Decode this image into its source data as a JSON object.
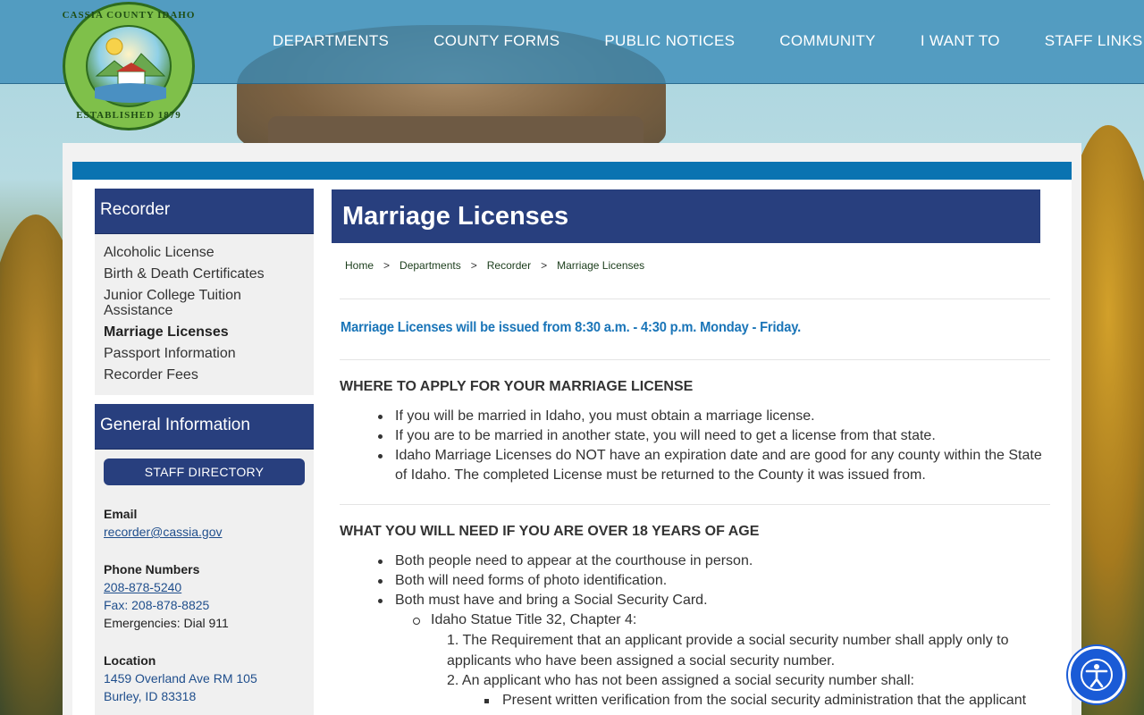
{
  "logo": {
    "top_text": "CASSIA COUNTY IDAHO",
    "bottom_text": "ESTABLISHED 1879"
  },
  "nav": {
    "items": [
      "DEPARTMENTS",
      "COUNTY FORMS",
      "PUBLIC NOTICES",
      "COMMUNITY",
      "I WANT TO",
      "STAFF LINKS"
    ]
  },
  "sidebar": {
    "title": "Recorder",
    "links": [
      "Alcoholic License",
      "Birth & Death Certificates",
      "Junior College Tuition Assistance",
      "Marriage Licenses",
      "Passport Information",
      "Recorder Fees"
    ],
    "active_link": "Marriage Licenses",
    "info_title": "General Information",
    "staff_button": "STAFF DIRECTORY",
    "email_label": "Email",
    "email": "recorder@cassia.gov",
    "phone_label": "Phone Numbers",
    "phone": "208-878-5240",
    "fax": "Fax: 208-878-8825",
    "emergencies": "Emergencies: Dial 911",
    "location_label": "Location",
    "address1": "1459 Overland Ave RM 105",
    "address2": "Burley, ID 83318"
  },
  "main": {
    "title": "Marriage Licenses",
    "breadcrumb": [
      "Home",
      "Departments",
      "Recorder",
      "Marriage Licenses"
    ],
    "breadcrumb_sep": ">",
    "hours_note": "Marriage Licenses will be issued from 8:30 a.m. - 4:30 p.m. Monday - Friday.",
    "section1": {
      "heading": "WHERE TO APPLY FOR YOUR MARRIAGE LICENSE",
      "items": [
        "If you will be married in Idaho, you must obtain a marriage license.",
        "If you are to be married in another state, you will need to get a license from that state.",
        "Idaho Marriage Licenses do NOT have an expiration date and are good for any county within the State of Idaho. The completed License must be returned to the County it was issued from."
      ]
    },
    "section2": {
      "heading": "WHAT YOU WILL NEED IF YOU ARE OVER 18 YEARS OF AGE",
      "items": [
        "Both people need to appear at the courthouse in person.",
        "Both will need forms of photo identification.",
        "Both must have and bring a Social Security Card."
      ],
      "sub_item": "Idaho Statue Title 32, Chapter 4:",
      "numbered": [
        "1. The Requirement that an applicant provide a social security number shall apply only to applicants who have been assigned a social security number.",
        "2. An applicant who has not been assigned a social security number shall:"
      ],
      "square_item": "Present written verification from the social security administration that the applicant"
    }
  },
  "colors": {
    "navy": "#283f7e",
    "accent_blue": "#0a73b1",
    "link_blue": "#1a75b8",
    "a11y_blue": "#1a5bd6"
  },
  "icons": {
    "accessibility": "accessibility-icon"
  }
}
